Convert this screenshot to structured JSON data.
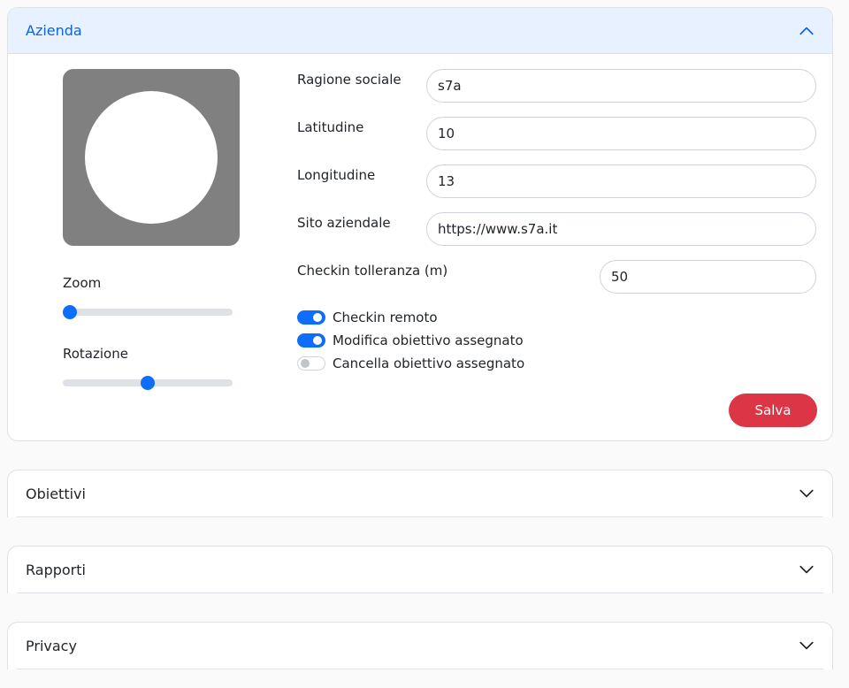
{
  "sections": {
    "azienda": {
      "title": "Azienda"
    },
    "obiettivi": {
      "title": "Obiettivi"
    },
    "rapporti": {
      "title": "Rapporti"
    },
    "privacy": {
      "title": "Privacy"
    }
  },
  "photo_editor": {
    "zoom_label": "Zoom",
    "zoom_value": 0,
    "rotation_label": "Rotazione",
    "rotation_value": 0.5
  },
  "form": {
    "ragione_sociale": {
      "label": "Ragione sociale",
      "value": "s7a"
    },
    "latitudine": {
      "label": "Latitudine",
      "value": "10"
    },
    "longitudine": {
      "label": "Longitudine",
      "value": "13"
    },
    "sito_aziendale": {
      "label": "Sito aziendale",
      "value": "https://www.s7a.it"
    },
    "checkin_tolleranza": {
      "label": "Checkin tolleranza (m)",
      "value": "50"
    }
  },
  "switches": {
    "checkin_remoto": {
      "label": "Checkin remoto",
      "checked": true
    },
    "modifica_obiettivo": {
      "label": "Modifica obiettivo assegnato",
      "checked": true
    },
    "cancella_obiettivo": {
      "label": "Cancella obiettivo assegnato",
      "checked": false
    }
  },
  "save_label": "Salva",
  "colors": {
    "accent": "#0d6efd",
    "header_open_bg": "#e7f1ff",
    "header_open_text": "#0c63e4",
    "danger": "#dc3545"
  }
}
